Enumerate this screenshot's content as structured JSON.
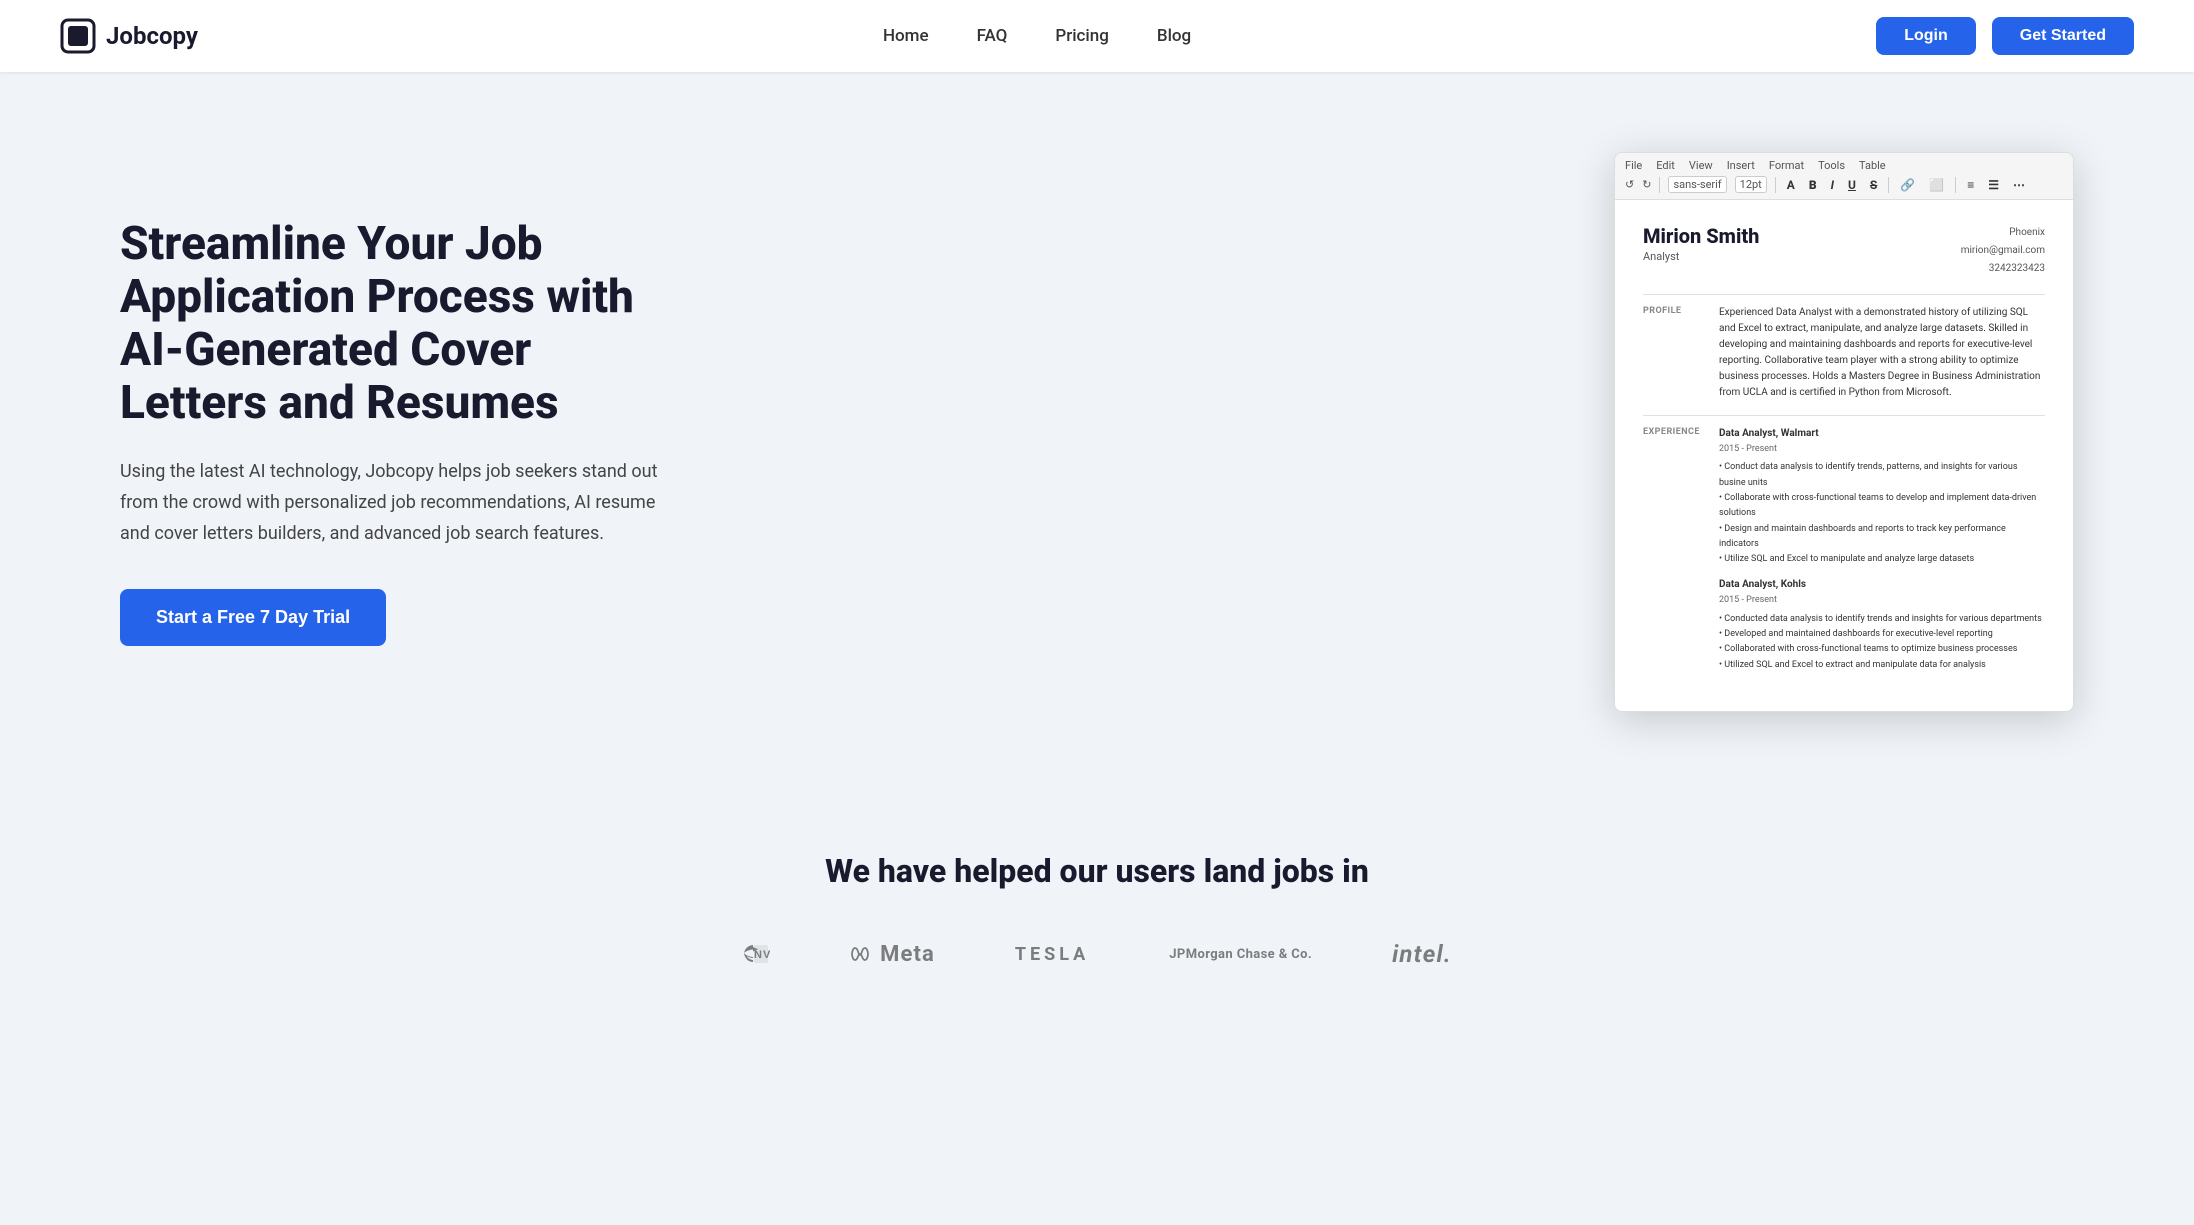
{
  "brand": {
    "name": "Jobcopy",
    "logo_alt": "Jobcopy Logo"
  },
  "nav": {
    "links": [
      {
        "label": "Home",
        "href": "#"
      },
      {
        "label": "FAQ",
        "href": "#"
      },
      {
        "label": "Pricing",
        "href": "#"
      },
      {
        "label": "Blog",
        "href": "#"
      }
    ],
    "login_label": "Login",
    "get_started_label": "Get Started"
  },
  "hero": {
    "title": "Streamline Your Job Application Process with AI-Generated Cover Letters and Resumes",
    "subtitle": "Using the latest AI technology, Jobcopy helps job seekers stand out from the crowd with personalized job recommendations, AI resume and cover letters builders, and advanced job search features.",
    "cta_label": "Start a Free 7 Day Trial"
  },
  "resume_mockup": {
    "menu_items": [
      "File",
      "Edit",
      "View",
      "Insert",
      "Format",
      "Tools",
      "Table"
    ],
    "font": "sans-serif",
    "size": "12pt",
    "name": "Mirion Smith",
    "role": "Analyst",
    "location": "Phoenix",
    "email": "mirion@gmail.com",
    "phone": "3242323423",
    "profile_label": "PROFILE",
    "profile_text": "Experienced Data Analyst with a demonstrated history of utilizing SQL and Excel to extract, manipulate, and analyze large datasets. Skilled in developing and maintaining dashboards and reports for executive-level reporting. Collaborative team player with a strong ability to optimize business processes. Holds a Masters Degree in Business Administration from UCLA and is certified in Python from Microsoft.",
    "experience_label": "EXPERIENCE",
    "jobs": [
      {
        "title": "Data Analyst, Walmart",
        "dates": "2015 - Present",
        "bullets": [
          "Conduct data analysis to identify trends, patterns, and insights for various busine units",
          "Collaborate with cross-functional teams to develop and implement data-driven solutions",
          "Design and maintain dashboards and reports to track key performance indicators",
          "Utilize SQL and Excel to manipulate and analyze large datasets"
        ]
      },
      {
        "title": "Data Analyst, Kohls",
        "dates": "2015 - Present",
        "bullets": [
          "Conducted data analysis to identify trends and insights for various departments",
          "Developed and maintained dashboards for executive-level reporting",
          "Collaborated with cross-functional teams to optimize business processes",
          "Utilized SQL and Excel to extract and manipulate data for analysis"
        ]
      }
    ]
  },
  "companies": {
    "title": "We have helped our users land jobs in",
    "logos": [
      "NVIDIA",
      "Meta",
      "TESLA",
      "JPMorgan Chase & Co.",
      "intel."
    ]
  }
}
